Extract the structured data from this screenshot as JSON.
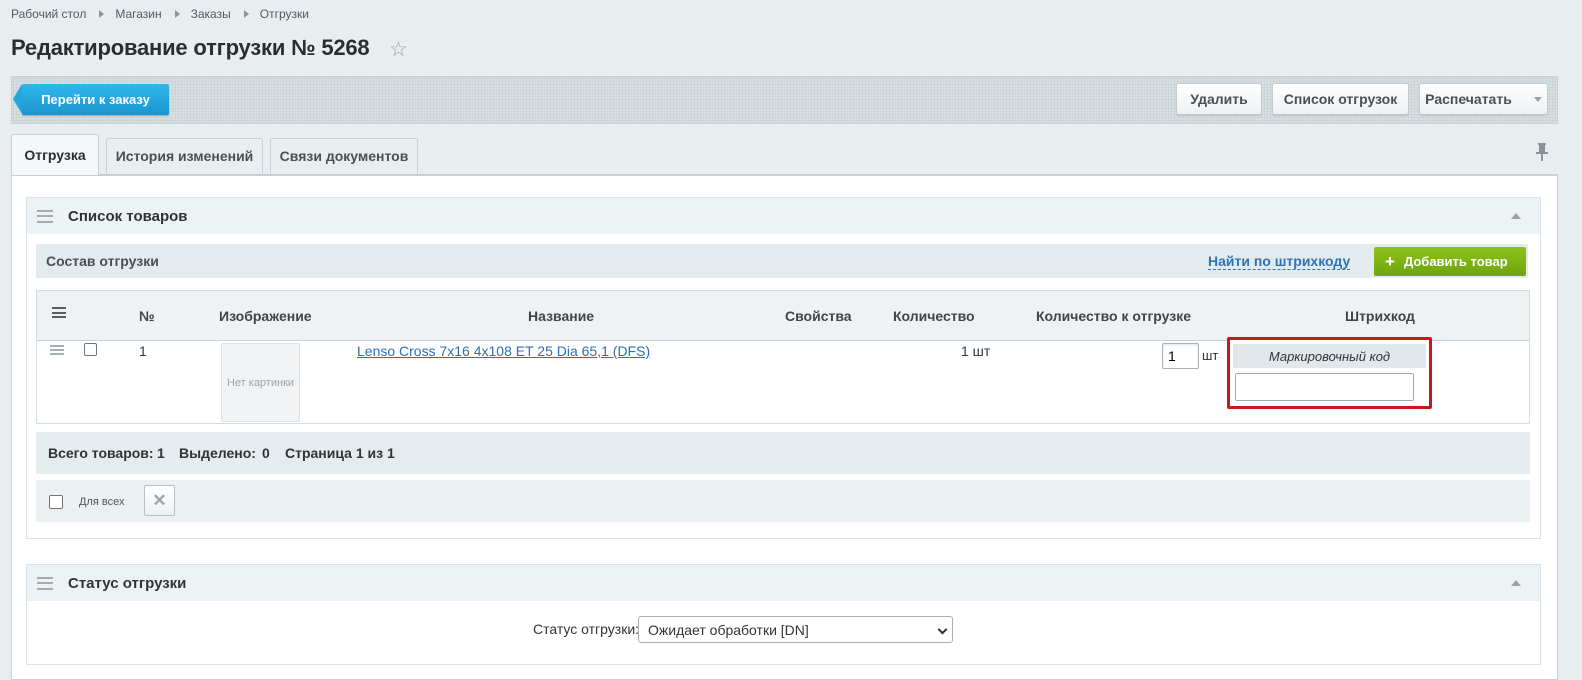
{
  "breadcrumb": [
    "Рабочий стол",
    "Магазин",
    "Заказы",
    "Отгрузки"
  ],
  "page_title": "Редактирование отгрузки № 5268",
  "toolbar": {
    "goto_order": "Перейти к заказу",
    "delete": "Удалить",
    "shipment_list": "Список отгрузок",
    "print": "Распечатать"
  },
  "tabs": [
    "Отгрузка",
    "История изменений",
    "Связи документов"
  ],
  "products_section": {
    "title": "Список товаров",
    "subbar_title": "Состав отгрузки",
    "find_by_barcode": "Найти по штрихкоду",
    "add_product": "Добавить товар",
    "columns": [
      "№",
      "Изображение",
      "Название",
      "Свойства",
      "Количество",
      "Количество к отгрузке",
      "Штрихкод"
    ],
    "rows": [
      {
        "num": "1",
        "image_text": "Нет картинки",
        "name": "Lenso Cross 7x16 4x108 ET 25 Dia 65,1 (DFS)",
        "quantity": "1 шт",
        "ship_quantity": "1",
        "ship_unit": "шт",
        "marking_label": "Маркировочный код",
        "marking_value": ""
      }
    ],
    "footer": {
      "total_label": "Всего товаров:",
      "total_value": "1",
      "selected_label": "Выделено:",
      "selected_value": "0",
      "page_text": "Страница 1 из 1"
    },
    "for_all": "Для всех"
  },
  "status_section": {
    "title": "Статус отгрузки",
    "label": "Статус отгрузки:",
    "selected": "Ожидает обработки [DN]"
  },
  "colors": {
    "accent_blue": "#1b96d0",
    "add_green": "#7ab313",
    "highlight_red": "#c8181e",
    "link": "#2f6eb0"
  }
}
